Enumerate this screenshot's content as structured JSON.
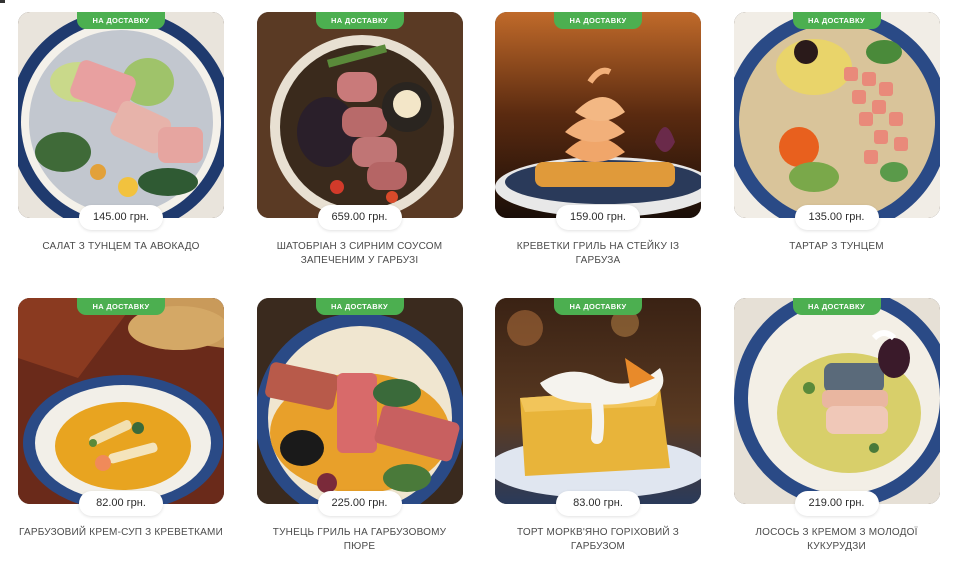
{
  "badge_label": "НА ДОСТАВКУ",
  "products": [
    {
      "title": "САЛАТ З ТУНЦЕМ ТА АВОКАДО",
      "price": "145.00 грн."
    },
    {
      "title": "ШАТОБРІАН З СИРНИМ СОУСОМ ЗАПЕЧЕНИМ У ГАРБУЗІ",
      "price": "659.00 грн."
    },
    {
      "title": "КРЕВЕТКИ ГРИЛЬ НА СТЕЙКУ ІЗ ГАРБУЗА",
      "price": "159.00 грн."
    },
    {
      "title": "ТАРТАР З ТУНЦЕМ",
      "price": "135.00 грн."
    },
    {
      "title": "ГАРБУЗОВИЙ КРЕМ-СУП З КРЕВЕТКАМИ",
      "price": "82.00 грн."
    },
    {
      "title": "ТУНЕЦЬ ГРИЛЬ НА ГАРБУЗОВОМУ ПЮРЕ",
      "price": "225.00 грн."
    },
    {
      "title": "ТОРТ МОРКВ'ЯНО ГОРІХОВИЙ З ГАРБУЗОМ",
      "price": "83.00 грн."
    },
    {
      "title": "ЛОСОСЬ З КРЕМОМ З МОЛОДОЇ КУКУРУДЗИ",
      "price": "219.00 грн."
    }
  ],
  "colors": {
    "badge": "#4caf50",
    "price_bg": "#ffffff",
    "title_text": "#4a4a4a"
  }
}
